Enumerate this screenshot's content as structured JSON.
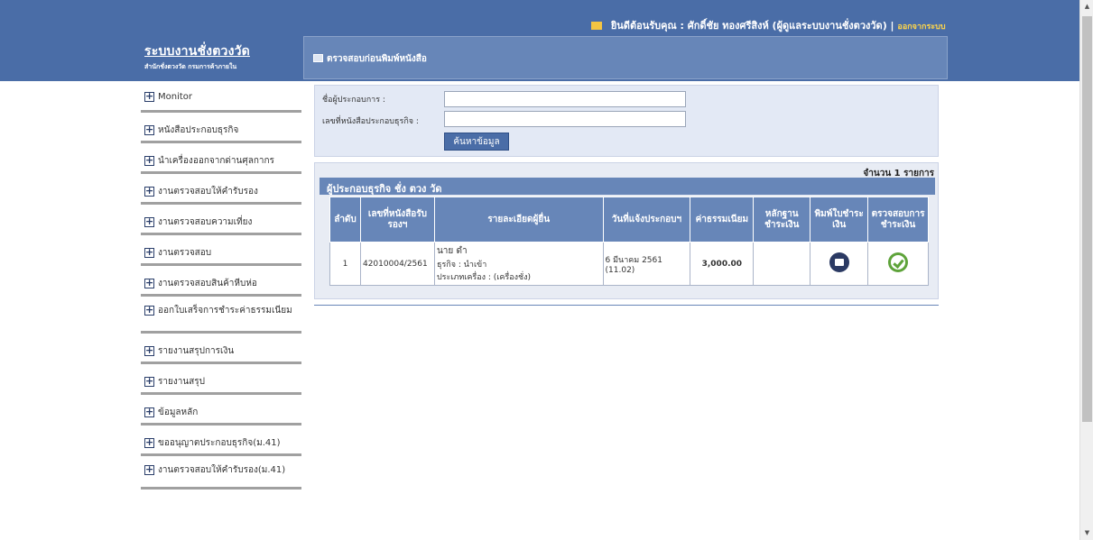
{
  "header": {
    "welcome": "ยินดีต้อนรับคุณ : ศักดิ์ชัย ทองศรีสิงห์ (ผู้ดูแลระบบงานชั่งตวงวัด) |",
    "logout": "ออกจากระบบ",
    "brand_title": "ระบบงานชั่งตวงวัด",
    "brand_sub": "สำนักชั่งตวงวัด กรมการค้าภายใน",
    "page_title": "ตรวจสอบก่อนพิมพ์หนังสือ"
  },
  "sidebar": {
    "items": [
      {
        "label": "Monitor"
      },
      {
        "label": "หนังสือประกอบธุรกิจ"
      },
      {
        "label": "นำเครื่องออกจากด่านศุลกากร"
      },
      {
        "label": "งานตรวจสอบให้คำรับรอง"
      },
      {
        "label": "งานตรวจสอบความเที่ยง"
      },
      {
        "label": "งานตรวจสอบ"
      },
      {
        "label": "งานตรวจสอบสินค้าหีบห่อ"
      },
      {
        "label": "ออกใบเสร็จการชำระค่าธรรมเนียม"
      },
      {
        "label": "รายงานสรุปการเงิน"
      },
      {
        "label": "รายงานสรุป"
      },
      {
        "label": "ข้อมูลหลัก"
      },
      {
        "label": "ขออนุญาตประกอบธุรกิจ(ม.41)"
      },
      {
        "label": "งานตรวจสอบให้คำรับรอง(ม.41)"
      }
    ]
  },
  "search": {
    "operator_label": "ชื่อผู้ประกอบการ :",
    "operator_value": "",
    "license_label": "เลขที่หนังสือประกอบธุรกิจ :",
    "license_value": "",
    "button_label": "ค้นหาข้อมูล"
  },
  "result": {
    "count_text": "จำนวน 1 รายการ",
    "section_title": "ผู้ประกอบธุรกิจ ชั่ง ตวง วัด",
    "columns": [
      "ลำดับ",
      "เลขที่หนังสือรับรองฯ",
      "รายละเอียดผู้ยื่น",
      "วันที่แจ้งประกอบฯ",
      "ค่าธรรมเนียม",
      "หลักฐานชำระเงิน",
      "พิมพ์ใบชำระเงิน",
      "ตรวจสอบการชำระเงิน"
    ],
    "rows": [
      {
        "no": "1",
        "license_no": "42010004/2561",
        "detail_name": "นาย ดำ",
        "detail_business": "ธุรกิจ : นำเข้า",
        "detail_type": "ประเภทเครื่อง : (เครื่องชั่ง)",
        "date": "6 มีนาคม 2561",
        "time": "(11.02)",
        "fee": "3,000.00",
        "evidence": ""
      }
    ]
  },
  "icons": {
    "print": "printer-icon",
    "check": "check-circle-icon",
    "mail": "mail-icon",
    "plus": "plus-box-icon"
  },
  "colors": {
    "header_bg": "#4a6da7",
    "panel_bg": "#6786b8",
    "fee_text": "#1f3ec2",
    "check_green": "#5ea33a"
  }
}
